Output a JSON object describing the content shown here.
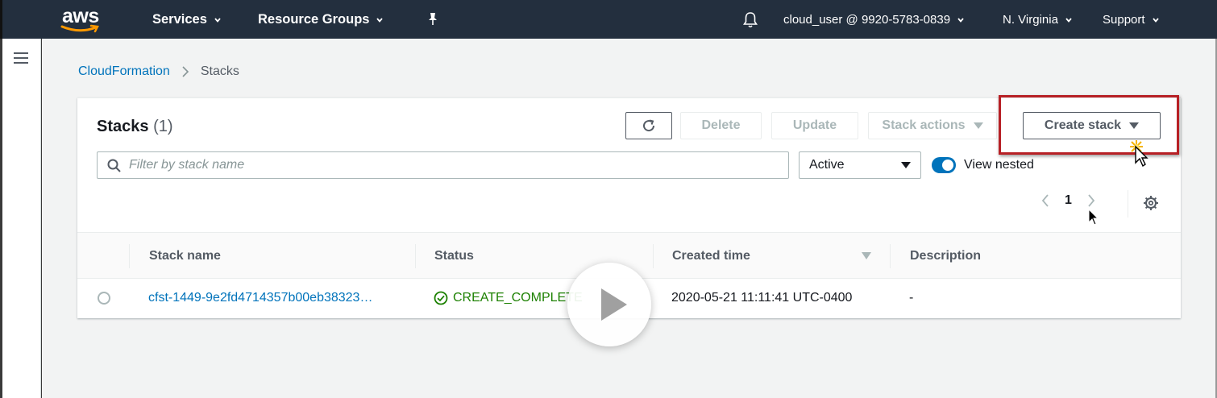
{
  "topnav": {
    "logo_text": "aws",
    "services": "Services",
    "resource_groups": "Resource Groups",
    "account": "cloud_user @ 9920-5783-0839",
    "region": "N. Virginia",
    "support": "Support"
  },
  "breadcrumb": {
    "root": "CloudFormation",
    "current": "Stacks"
  },
  "panel": {
    "title": "Stacks",
    "count": "(1)",
    "buttons": {
      "delete": "Delete",
      "update": "Update",
      "stack_actions": "Stack actions",
      "create_stack": "Create stack"
    },
    "search_placeholder": "Filter by stack name",
    "filter_select": "Active",
    "view_nested_label": "View nested",
    "view_nested_on": true,
    "page_number": "1"
  },
  "table": {
    "columns": [
      "Stack name",
      "Status",
      "Created time",
      "Description"
    ],
    "rows": [
      {
        "stack_name": "cfst-1449-9e2fd4714357b00eb38323…",
        "status": "CREATE_COMPLETE",
        "created_time": "2020-05-21 11:11:41 UTC-0400",
        "description": "-"
      }
    ]
  },
  "colors": {
    "nav_bg": "#232f3e",
    "link": "#0073bb",
    "success": "#1d8102",
    "highlight": "#b72025"
  }
}
